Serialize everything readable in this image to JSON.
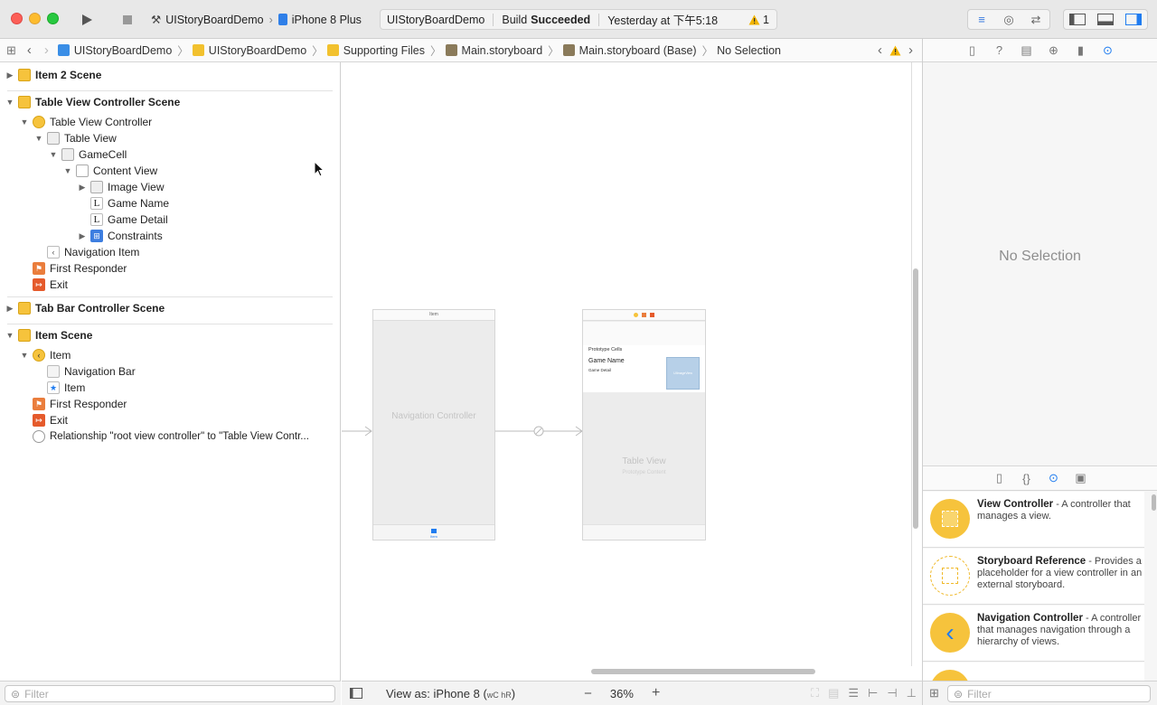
{
  "toolbar": {
    "scheme_project": "UIStoryBoardDemo",
    "scheme_device": "iPhone 8 Plus",
    "status_project": "UIStoryBoardDemo",
    "status_build_prefix": "Build",
    "status_build_result": "Succeeded",
    "status_time": "Yesterday at 下午5:18",
    "warning_count": "1"
  },
  "jumpbar": {
    "items": [
      "UIStoryBoardDemo",
      "UIStoryBoardDemo",
      "Supporting Files",
      "Main.storyboard",
      "Main.storyboard (Base)",
      "No Selection"
    ]
  },
  "outline": {
    "rows": [
      {
        "label": "Item 2 Scene"
      },
      {
        "label": "Table View Controller Scene"
      },
      {
        "label": "Table View Controller"
      },
      {
        "label": "Table View"
      },
      {
        "label": "GameCell"
      },
      {
        "label": "Content View"
      },
      {
        "label": "Image View"
      },
      {
        "label": "Game Name"
      },
      {
        "label": "Game Detail"
      },
      {
        "label": "Constraints"
      },
      {
        "label": "Navigation Item"
      },
      {
        "label": "First Responder"
      },
      {
        "label": "Exit"
      },
      {
        "label": "Tab Bar Controller Scene"
      },
      {
        "label": "Item Scene"
      },
      {
        "label": "Item"
      },
      {
        "label": "Navigation Bar"
      },
      {
        "label": "Item"
      },
      {
        "label": "First Responder"
      },
      {
        "label": "Exit"
      },
      {
        "label": "Relationship \"root view controller\" to \"Table View Contr..."
      }
    ],
    "filter_placeholder": "Filter"
  },
  "canvas": {
    "nav_controller_title": "Navigation Controller",
    "nav_bar_title": "Item",
    "tab_item": "Item",
    "prototype_cells": "Prototype Cells",
    "game_name": "Game Name",
    "game_detail": "Game Detail",
    "image_placeholder": "UIImageView",
    "table_view_title": "Table View",
    "table_view_subtitle": "Prototype Content"
  },
  "bottombar": {
    "view_as": "View as: iPhone 8 (",
    "view_as_traits": "wC hR",
    "view_as_end": ")",
    "zoom": "36%",
    "zoom_out": "−",
    "zoom_in": "+"
  },
  "inspector": {
    "no_selection": "No Selection",
    "library": [
      {
        "title": "View Controller",
        "desc": " - A controller that manages a view."
      },
      {
        "title": "Storyboard Reference",
        "desc": " - Provides a placeholder for a view controller in an external storyboard."
      },
      {
        "title": "Navigation Controller",
        "desc": " - A controller that manages navigation through a hierarchy of views."
      }
    ],
    "filter_placeholder": "Filter"
  },
  "colors": {
    "accent": "#1f7cf0",
    "scene": "#f6c33c",
    "warning": "#f2b400"
  }
}
